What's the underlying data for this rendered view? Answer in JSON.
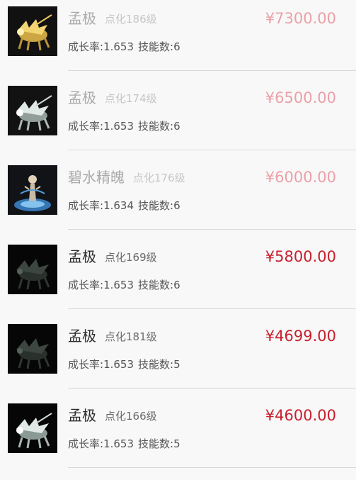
{
  "listings": [
    {
      "name": "孟极",
      "level": "点化186级",
      "price": "¥7300.00",
      "growth_label": "成长率:",
      "growth": "1.653",
      "skills_label": "技能数:",
      "skills": "6",
      "faded": true,
      "pet_icon": "golden-beast-icon"
    },
    {
      "name": "孟极",
      "level": "点化174级",
      "price": "¥6500.00",
      "growth_label": "成长率:",
      "growth": "1.653",
      "skills_label": "技能数:",
      "skills": "6",
      "faded": true,
      "pet_icon": "white-beast-icon"
    },
    {
      "name": "碧水精魄",
      "level": "点化176级",
      "price": "¥6000.00",
      "growth_label": "成长率:",
      "growth": "1.634",
      "skills_label": "技能数:",
      "skills": "6",
      "faded": true,
      "pet_icon": "water-spirit-icon"
    },
    {
      "name": "孟极",
      "level": "点化169级",
      "price": "¥5800.00",
      "growth_label": "成长率:",
      "growth": "1.653",
      "skills_label": "技能数:",
      "skills": "6",
      "faded": false,
      "pet_icon": "dark-beast-icon"
    },
    {
      "name": "孟极",
      "level": "点化181级",
      "price": "¥4699.00",
      "growth_label": "成长率:",
      "growth": "1.653",
      "skills_label": "技能数:",
      "skills": "5",
      "faded": false,
      "pet_icon": "dark-beast-icon"
    },
    {
      "name": "孟极",
      "level": "点化166级",
      "price": "¥4600.00",
      "growth_label": "成长率:",
      "growth": "1.653",
      "skills_label": "技能数:",
      "skills": "5",
      "faded": false,
      "pet_icon": "white-beast-icon"
    }
  ],
  "colors": {
    "price_active": "#c8202e",
    "price_faded": "#eba0a8",
    "name_active": "#2b2b2b",
    "name_faded": "#aaaaaa"
  }
}
